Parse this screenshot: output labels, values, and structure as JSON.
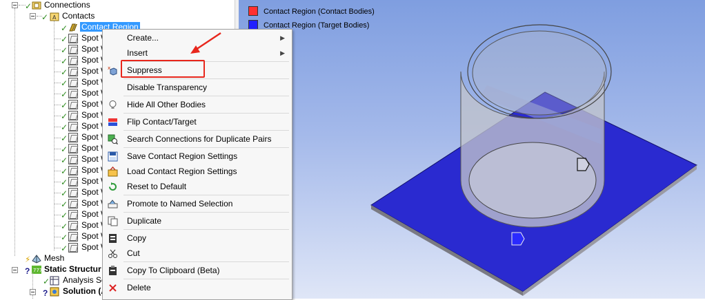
{
  "tree": {
    "connections": "Connections",
    "contacts": "Contacts",
    "contact_region": "Contact Region",
    "spot_items": [
      "Spot W",
      "Spot W",
      "Spot W",
      "Spot W",
      "Spot W",
      "Spot W",
      "Spot W",
      "Spot W",
      "Spot W",
      "Spot W",
      "Spot W",
      "Spot W",
      "Spot W",
      "Spot W",
      "Spot W",
      "Spot W",
      "Spot W",
      "Spot W",
      "Spot W",
      "Spot W"
    ],
    "mesh": "Mesh",
    "static_structural": "Static Structur",
    "analysis_settings": "Analysis Set",
    "solution": "Solution (A"
  },
  "legend": {
    "contact": {
      "label": "Contact Region (Contact Bodies)",
      "color": "#ff3030"
    },
    "target": {
      "label": "Contact Region (Target Bodies)",
      "color": "#2020ff"
    }
  },
  "menu": {
    "create": "Create...",
    "insert": "Insert",
    "suppress": "Suppress",
    "disable_transparency": "Disable Transparency",
    "hide_all_other": "Hide All Other Bodies",
    "flip": "Flip Contact/Target",
    "search_connections": "Search Connections for Duplicate Pairs",
    "save_settings": "Save Contact Region Settings",
    "load_settings": "Load Contact Region Settings",
    "reset": "Reset to Default",
    "promote": "Promote to Named Selection",
    "duplicate": "Duplicate",
    "copy": "Copy",
    "cut": "Cut",
    "copy_clipboard": "Copy To Clipboard (Beta)",
    "delete": "Delete"
  },
  "colors": {
    "highlight_box": "#e8261c",
    "plate": "#2a2ad0",
    "cylinder": "#b8bcc8"
  }
}
